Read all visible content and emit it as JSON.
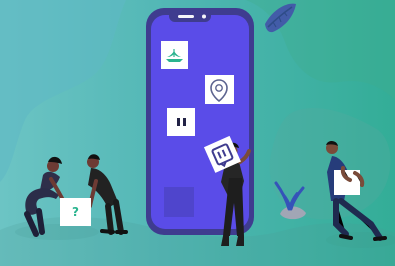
{
  "illustration": {
    "background_colors": [
      "#6cc4c4",
      "#52b7b5",
      "#33ad97"
    ],
    "phone_color": "#3f3c8f",
    "screen_color": "#5a4ce8",
    "card_color": "#ffffff",
    "accent_color": "#2bb48f",
    "question_mark": "?",
    "icons": [
      "leaf-icon",
      "location-pin-icon",
      "pause-icon",
      "twitch-like-icon",
      "question-mark-icon"
    ]
  }
}
